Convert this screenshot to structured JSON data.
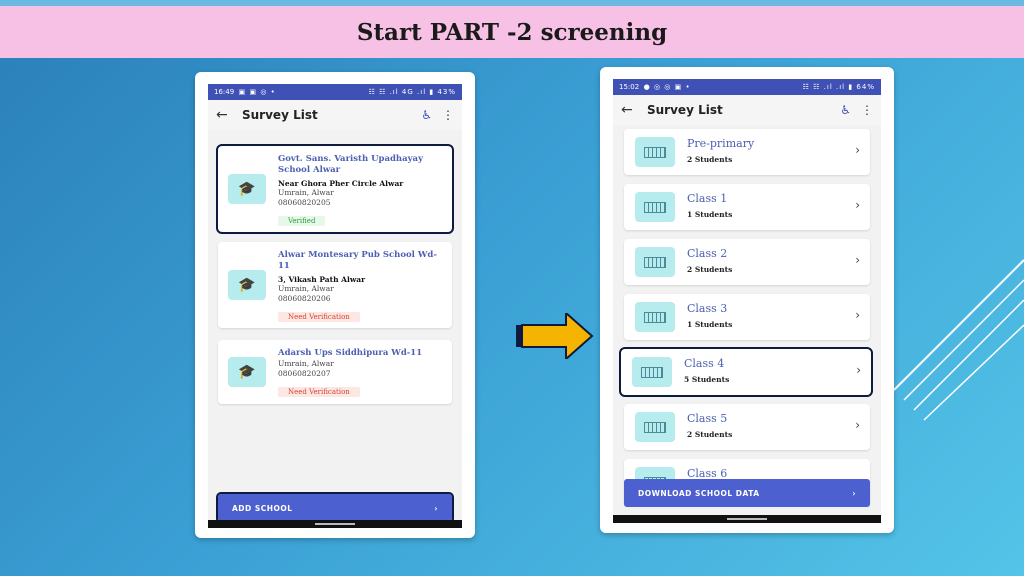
{
  "slide": {
    "title": "Start PART -2 screening"
  },
  "left_phone": {
    "status_time": "16:49",
    "status_icons": "▣ ▣ ◎ •",
    "status_right": "☷ ☷ .ıl 4G .ıl ▮ 43%",
    "appbar_title": "Survey List",
    "schools": [
      {
        "name": "Govt.  Sans. Varisth Upadhayay School Alwar",
        "address": "Near Ghora Pher Circle Alwar",
        "location": "Umrain, Alwar",
        "code": "08060820205",
        "status": "Verified"
      },
      {
        "name": "Alwar Montesary Pub School Wd-11",
        "address": "3, Vikash Path Alwar",
        "location": "Umrain, Alwar",
        "code": "08060820206",
        "status": "Need Verification"
      },
      {
        "name": "Adarsh Ups Siddhipura Wd-11",
        "location": "Umrain, Alwar",
        "code": "08060820207",
        "status": "Need Verification"
      }
    ],
    "button_label": "ADD SCHOOL"
  },
  "right_phone": {
    "status_time": "15:02",
    "status_icons": "● ◎ ◎ ▣ •",
    "status_right": "☷ ☷ .ıl .ıl ▮ 64%",
    "appbar_title": "Survey List",
    "classes": [
      {
        "name": "Pre-primary",
        "count": "2 Students"
      },
      {
        "name": "Class 1",
        "count": "1 Students"
      },
      {
        "name": "Class 2",
        "count": "2 Students"
      },
      {
        "name": "Class 3",
        "count": "1 Students"
      },
      {
        "name": "Class 4",
        "count": "5 Students"
      },
      {
        "name": "Class 5",
        "count": "2 Students"
      },
      {
        "name": "Class 6",
        "count": ""
      }
    ],
    "button_label": "DOWNLOAD SCHOOL DATA"
  },
  "glyphs": {
    "back": "←",
    "more": "⋮",
    "accessibility": "♿",
    "chevron": "›",
    "school": "🎓"
  },
  "colors": {
    "title_bar": "#f7c1e6",
    "app_primary": "#3f51b5",
    "button": "#4c60cf",
    "arrow": "#f5b400",
    "highlight_border": "#0d1b3e"
  }
}
